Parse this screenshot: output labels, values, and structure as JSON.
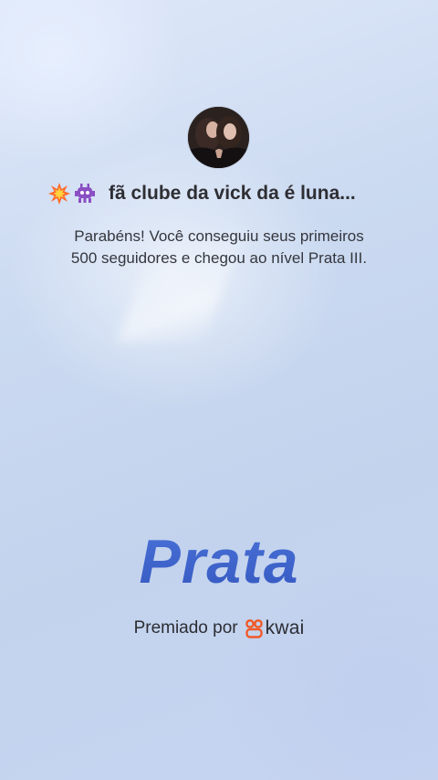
{
  "profile": {
    "avatar_icon": "profile-photo",
    "emojis": [
      "collision-emoji",
      "alien-monster-emoji"
    ],
    "club_name": "fã clube da vick da é luna..."
  },
  "message": {
    "line1": "Parabéns! Você conseguiu seus primeiros",
    "line2": "500 seguidores e chegou ao nível Prata III."
  },
  "level": {
    "title": "Prata"
  },
  "awarded": {
    "label": "Premiado por",
    "brand": "kwai",
    "brand_color": "#f05a28"
  },
  "colors": {
    "title_blue": "#3e63c9",
    "background": "#c5d6ef"
  }
}
